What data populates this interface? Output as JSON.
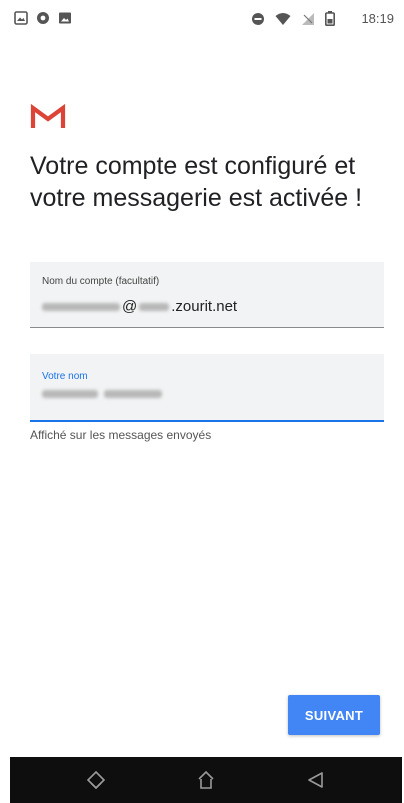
{
  "status_bar": {
    "time": "18:19",
    "left_icons": [
      "image-box-icon",
      "shield-icon",
      "image-icon"
    ],
    "right_icons": [
      "do-not-disturb-icon",
      "wifi-icon",
      "no-signal-icon",
      "battery-icon"
    ]
  },
  "app": {
    "logo": "gmail-logo",
    "accent_color": "#db4437"
  },
  "page": {
    "title": "Votre compte est configuré et votre messagerie est activée !"
  },
  "account_field": {
    "label": "Nom du compte (facultatif)",
    "value_suffix": "@",
    "domain_suffix": ".zourit.net"
  },
  "name_field": {
    "label": "Votre nom",
    "helper": "Affiché sur les messages envoyés"
  },
  "actions": {
    "next_label": "SUIVANT",
    "next_color": "#4285f4"
  },
  "nav_bar": {
    "buttons": [
      "recents-icon",
      "home-icon",
      "back-icon"
    ]
  }
}
